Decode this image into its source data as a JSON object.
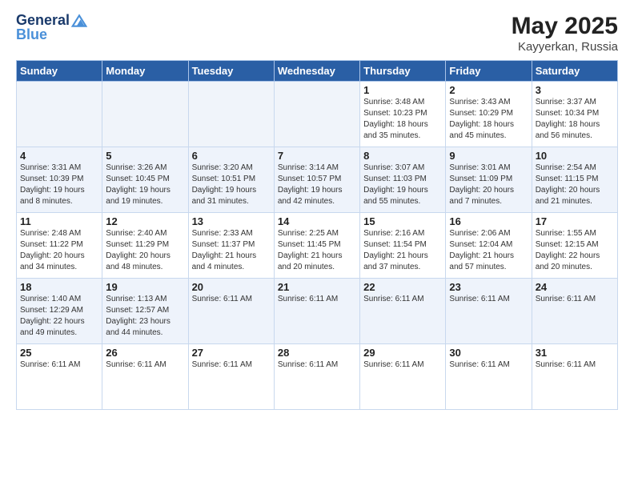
{
  "header": {
    "logo_general": "General",
    "logo_blue": "Blue",
    "month_title": "May 2025",
    "location": "Kayyerkan, Russia"
  },
  "days_of_week": [
    "Sunday",
    "Monday",
    "Tuesday",
    "Wednesday",
    "Thursday",
    "Friday",
    "Saturday"
  ],
  "weeks": [
    [
      {
        "num": "",
        "info": ""
      },
      {
        "num": "",
        "info": ""
      },
      {
        "num": "",
        "info": ""
      },
      {
        "num": "",
        "info": ""
      },
      {
        "num": "1",
        "info": "Sunrise: 3:48 AM\nSunset: 10:23 PM\nDaylight: 18 hours\nand 35 minutes."
      },
      {
        "num": "2",
        "info": "Sunrise: 3:43 AM\nSunset: 10:29 PM\nDaylight: 18 hours\nand 45 minutes."
      },
      {
        "num": "3",
        "info": "Sunrise: 3:37 AM\nSunset: 10:34 PM\nDaylight: 18 hours\nand 56 minutes."
      }
    ],
    [
      {
        "num": "4",
        "info": "Sunrise: 3:31 AM\nSunset: 10:39 PM\nDaylight: 19 hours\nand 8 minutes."
      },
      {
        "num": "5",
        "info": "Sunrise: 3:26 AM\nSunset: 10:45 PM\nDaylight: 19 hours\nand 19 minutes."
      },
      {
        "num": "6",
        "info": "Sunrise: 3:20 AM\nSunset: 10:51 PM\nDaylight: 19 hours\nand 31 minutes."
      },
      {
        "num": "7",
        "info": "Sunrise: 3:14 AM\nSunset: 10:57 PM\nDaylight: 19 hours\nand 42 minutes."
      },
      {
        "num": "8",
        "info": "Sunrise: 3:07 AM\nSunset: 11:03 PM\nDaylight: 19 hours\nand 55 minutes."
      },
      {
        "num": "9",
        "info": "Sunrise: 3:01 AM\nSunset: 11:09 PM\nDaylight: 20 hours\nand 7 minutes."
      },
      {
        "num": "10",
        "info": "Sunrise: 2:54 AM\nSunset: 11:15 PM\nDaylight: 20 hours\nand 21 minutes."
      }
    ],
    [
      {
        "num": "11",
        "info": "Sunrise: 2:48 AM\nSunset: 11:22 PM\nDaylight: 20 hours\nand 34 minutes."
      },
      {
        "num": "12",
        "info": "Sunrise: 2:40 AM\nSunset: 11:29 PM\nDaylight: 20 hours\nand 48 minutes."
      },
      {
        "num": "13",
        "info": "Sunrise: 2:33 AM\nSunset: 11:37 PM\nDaylight: 21 hours\nand 4 minutes."
      },
      {
        "num": "14",
        "info": "Sunrise: 2:25 AM\nSunset: 11:45 PM\nDaylight: 21 hours\nand 20 minutes."
      },
      {
        "num": "15",
        "info": "Sunrise: 2:16 AM\nSunset: 11:54 PM\nDaylight: 21 hours\nand 37 minutes."
      },
      {
        "num": "16",
        "info": "Sunrise: 2:06 AM\nSunset: 12:04 AM\nDaylight: 21 hours\nand 57 minutes."
      },
      {
        "num": "17",
        "info": "Sunrise: 1:55 AM\nSunset: 12:15 AM\nDaylight: 22 hours\nand 20 minutes."
      }
    ],
    [
      {
        "num": "18",
        "info": "Sunrise: 1:40 AM\nSunset: 12:29 AM\nDaylight: 22 hours\nand 49 minutes."
      },
      {
        "num": "19",
        "info": "Sunrise: 1:13 AM\nSunset: 12:57 AM\nDaylight: 23 hours\nand 44 minutes."
      },
      {
        "num": "20",
        "info": "Sunrise: 6:11 AM"
      },
      {
        "num": "21",
        "info": "Sunrise: 6:11 AM"
      },
      {
        "num": "22",
        "info": "Sunrise: 6:11 AM"
      },
      {
        "num": "23",
        "info": "Sunrise: 6:11 AM"
      },
      {
        "num": "24",
        "info": "Sunrise: 6:11 AM"
      }
    ],
    [
      {
        "num": "25",
        "info": "Sunrise: 6:11 AM"
      },
      {
        "num": "26",
        "info": "Sunrise: 6:11 AM"
      },
      {
        "num": "27",
        "info": "Sunrise: 6:11 AM"
      },
      {
        "num": "28",
        "info": "Sunrise: 6:11 AM"
      },
      {
        "num": "29",
        "info": "Sunrise: 6:11 AM"
      },
      {
        "num": "30",
        "info": "Sunrise: 6:11 AM"
      },
      {
        "num": "31",
        "info": "Sunrise: 6:11 AM"
      }
    ]
  ]
}
